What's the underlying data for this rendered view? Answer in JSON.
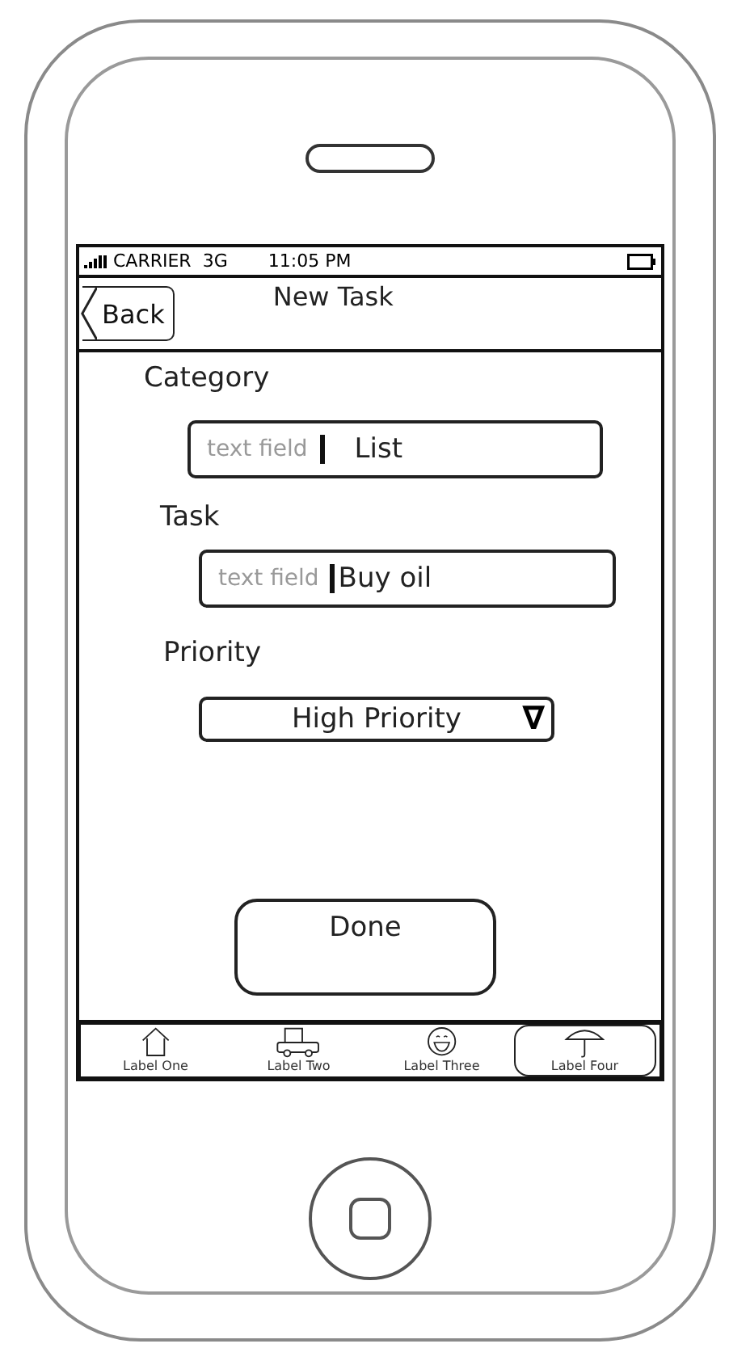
{
  "status_bar": {
    "carrier": "CARRIER",
    "network": "3G",
    "time": "11:05 PM"
  },
  "nav_bar": {
    "back": "Back",
    "title": "New Task"
  },
  "form": [
    {
      "kind": "text",
      "label": "Category",
      "hint": "text field",
      "value": "List"
    },
    {
      "kind": "text",
      "label": "Task",
      "hint": "text field",
      "value": "Buy oil"
    },
    {
      "kind": "dropdown",
      "label": "Priority",
      "value": "High Priority",
      "arrow": "∇"
    }
  ],
  "done_button": "Done",
  "tabs": [
    {
      "label": "Label One",
      "selected": false
    },
    {
      "label": "Label Two",
      "selected": false
    },
    {
      "label": "Label Three",
      "selected": false
    },
    {
      "label": "Label Four",
      "selected": true
    }
  ]
}
